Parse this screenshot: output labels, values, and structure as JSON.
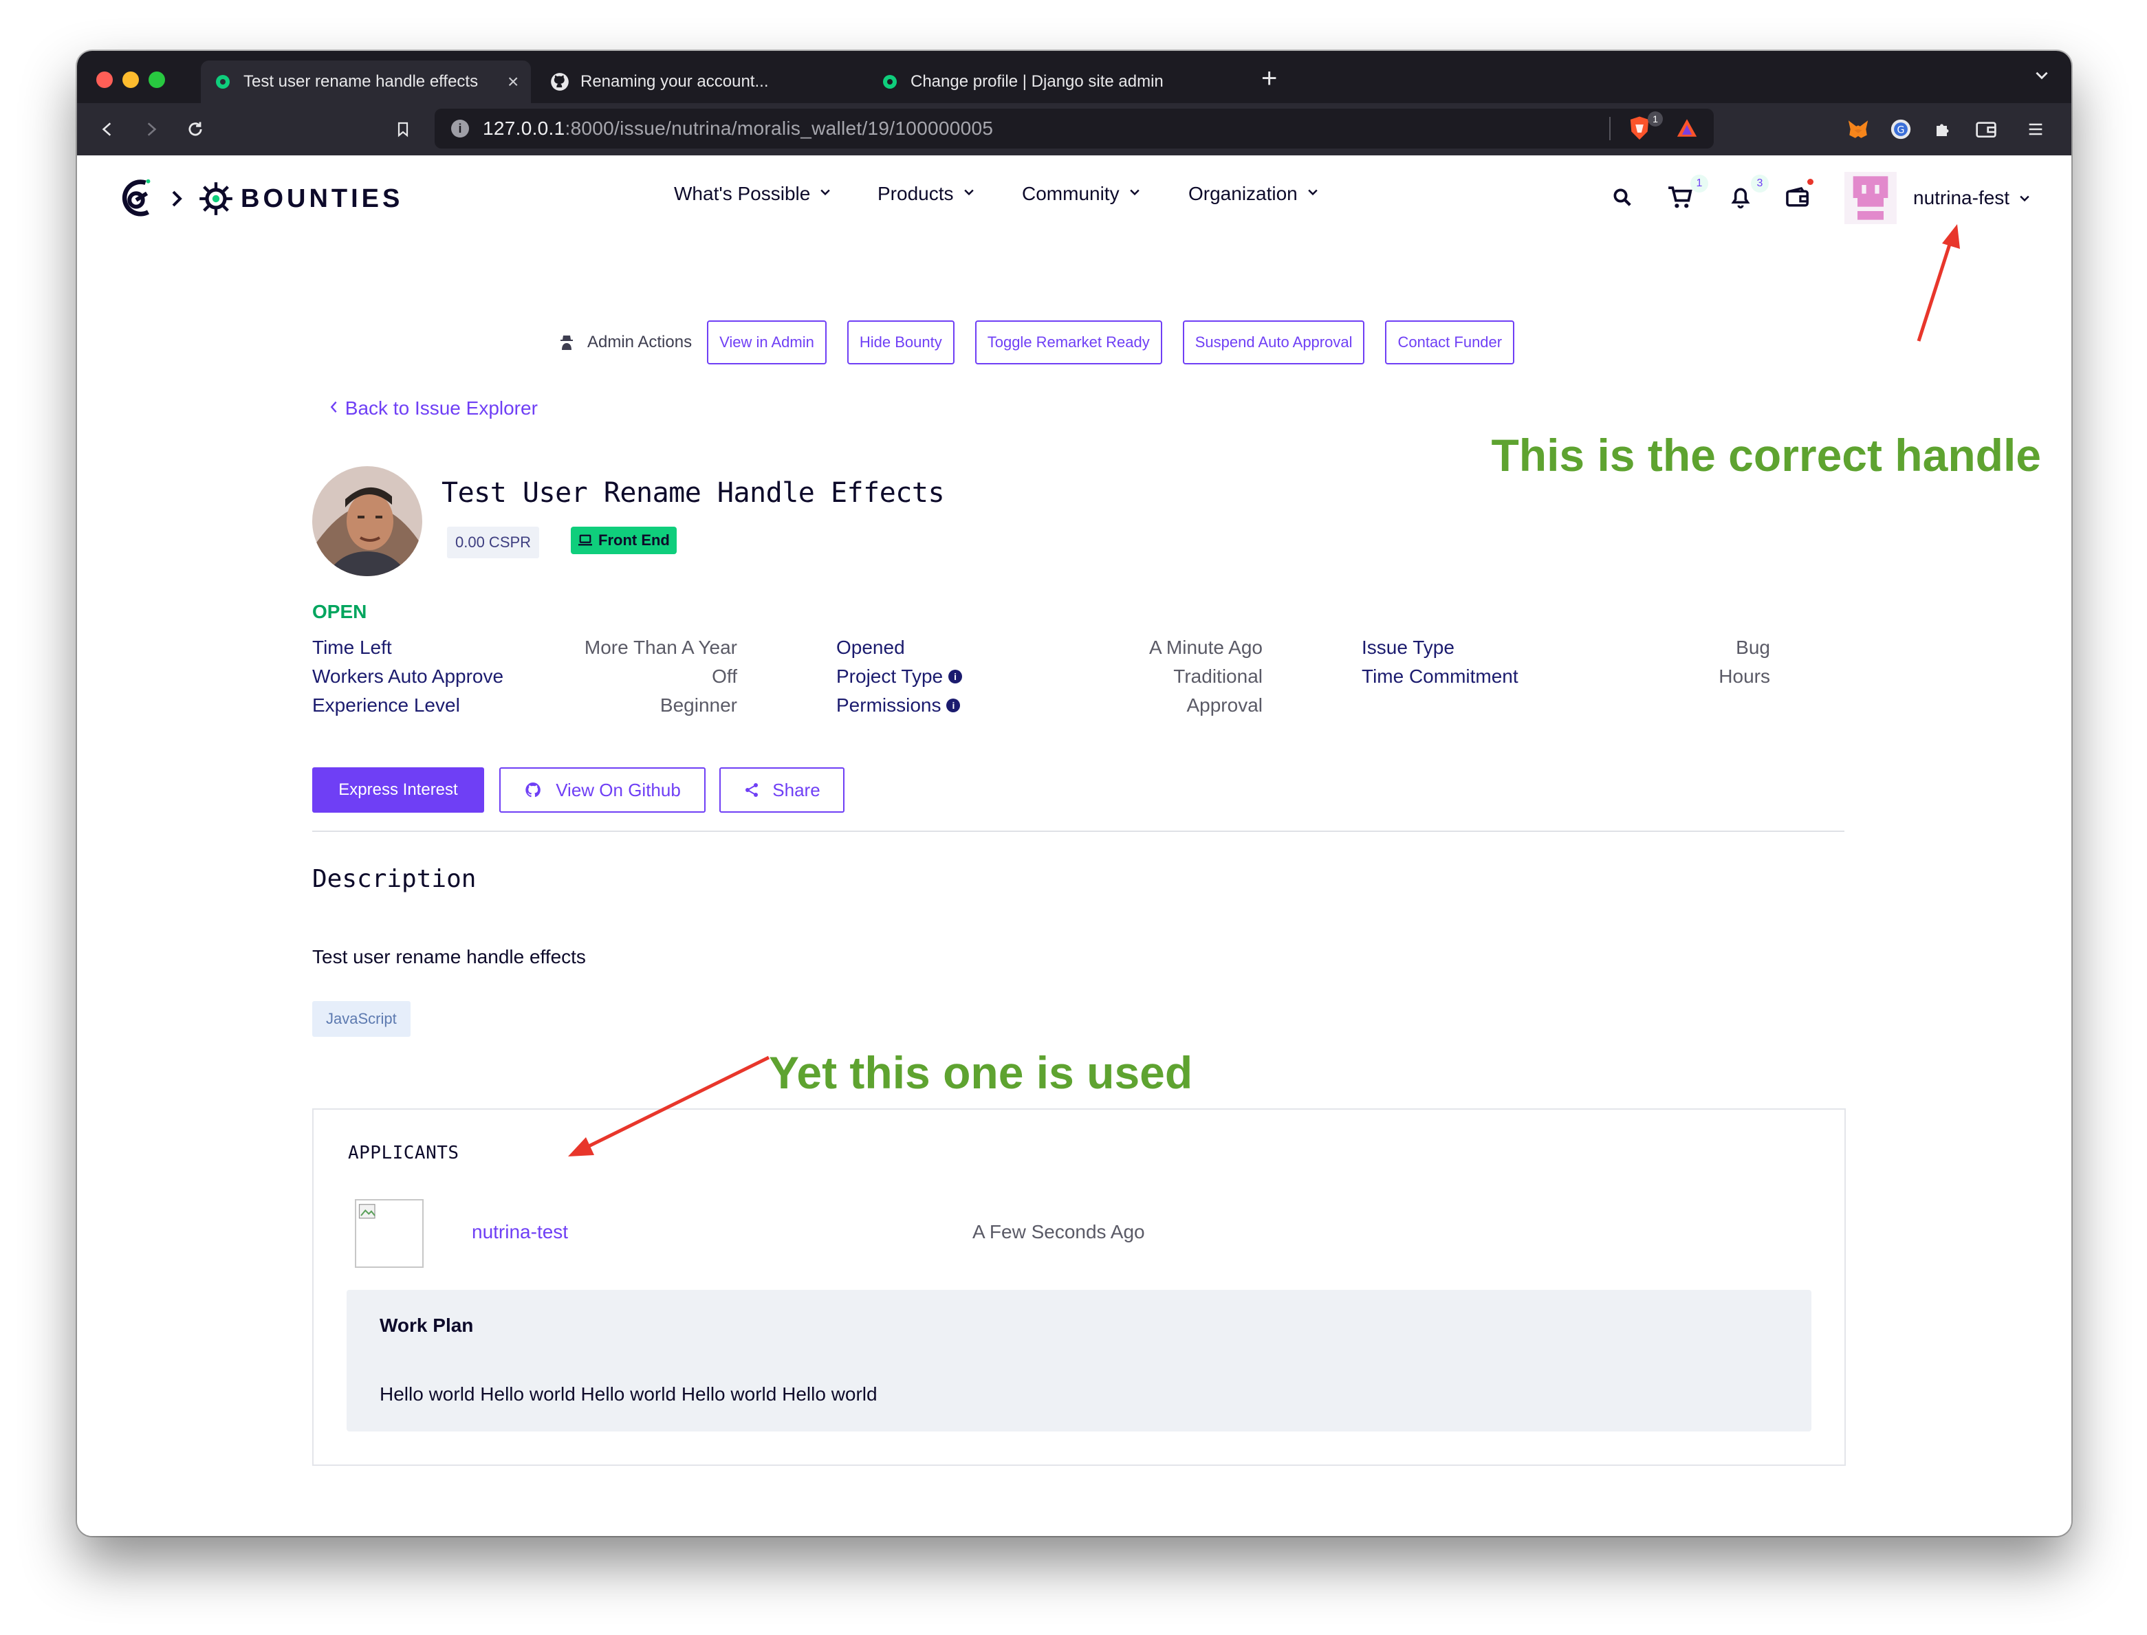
{
  "browser": {
    "tabs": [
      {
        "title": "Test user rename handle effects",
        "active": true
      },
      {
        "title": "Renaming your account...",
        "active": false
      },
      {
        "title": "Change profile | Django site admin",
        "active": false
      }
    ],
    "new_tab": "+",
    "url_host": "127.0.0.1",
    "url_rest": ":8000/issue/nutrina/moralis_wallet/19/100000005",
    "brave_badge": "1"
  },
  "site": {
    "brand": "BOUNTIES",
    "nav": [
      "What's Possible",
      "Products",
      "Community",
      "Organization"
    ],
    "cart_count": "1",
    "notif_count": "3",
    "username": "nutrina-fest"
  },
  "admin": {
    "label": "Admin Actions",
    "buttons": [
      "View in Admin",
      "Hide Bounty",
      "Toggle Remarket Ready",
      "Suspend Auto Approval",
      "Contact Funder"
    ]
  },
  "back_link": "Back to Issue Explorer",
  "annotations": {
    "top": "This is the correct handle",
    "bottom": "Yet this one is used"
  },
  "issue": {
    "title": "Test User Rename Handle Effects",
    "amount": "0.00 CSPR",
    "tag": "Front End",
    "status": "OPEN",
    "details": {
      "time_left_k": "Time Left",
      "time_left_v": "More Than A Year",
      "auto_approve_k": "Workers Auto Approve",
      "auto_approve_v": "Off",
      "experience_k": "Experience Level",
      "experience_v": "Beginner",
      "opened_k": "Opened",
      "opened_v": "A Minute Ago",
      "project_type_k": "Project Type",
      "project_type_v": "Traditional",
      "permissions_k": "Permissions",
      "permissions_v": "Approval",
      "issue_type_k": "Issue Type",
      "issue_type_v": "Bug",
      "time_commit_k": "Time Commitment",
      "time_commit_v": "Hours"
    },
    "actions": {
      "express": "Express Interest",
      "github": "View On Github",
      "share": "Share"
    },
    "description_heading": "Description",
    "description": "Test user rename handle effects",
    "keyword": "JavaScript"
  },
  "applicants": {
    "heading": "APPLICANTS",
    "list": [
      {
        "name": "nutrina-test",
        "time": "A Few Seconds Ago",
        "plan_heading": "Work Plan",
        "plan": "Hello world Hello world Hello world Hello world Hello world"
      }
    ]
  },
  "colors": {
    "accent": "#6f3ff5",
    "annotation": "#5ea330",
    "arrow": "#e8362b",
    "open": "#00a55e"
  }
}
